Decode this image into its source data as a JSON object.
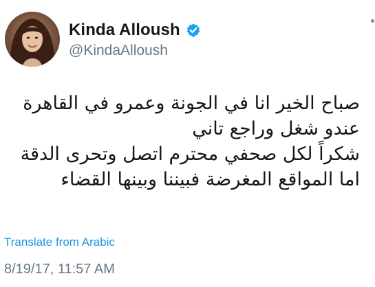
{
  "tweet": {
    "author": {
      "display_name": "Kinda Alloush",
      "handle": "@KindaAlloush",
      "verified": true
    },
    "text_lines": [
      "صباح الخير انا في الجونة وعمرو في القاهرة",
      "عندو شغل وراجع تاني",
      "شكراً لكل صحفي محترم اتصل وتحرى الدقة",
      "اما المواقع المغرضة فبيننا وبينها القضاء"
    ],
    "translate_label": "Translate from Arabic",
    "timestamp": "8/19/17, 11:57 AM"
  },
  "colors": {
    "text_primary": "#14171a",
    "text_secondary": "#657786",
    "link": "#1b95e0",
    "verified_badge": "#1da1f2"
  },
  "icons": {
    "verified": "verified-badge-icon",
    "avatar": "profile-photo"
  }
}
